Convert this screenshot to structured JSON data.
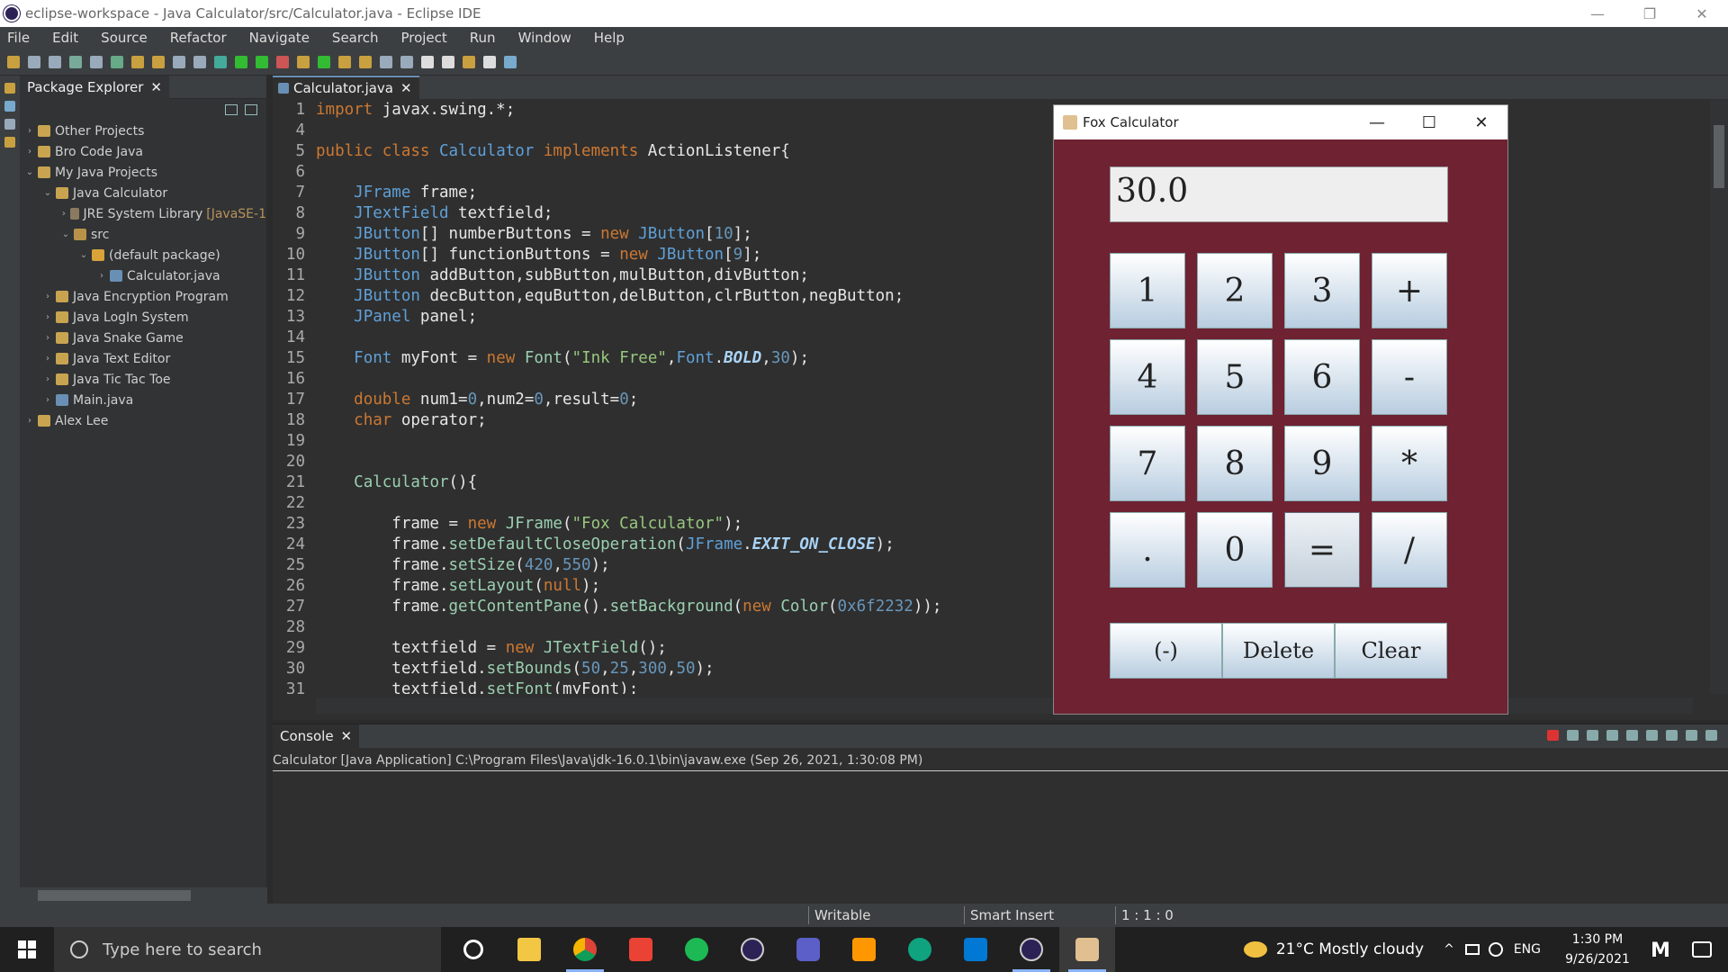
{
  "window": {
    "title": "eclipse-workspace - Java Calculator/src/Calculator.java - Eclipse IDE"
  },
  "menu": [
    "File",
    "Edit",
    "Source",
    "Refactor",
    "Navigate",
    "Search",
    "Project",
    "Run",
    "Window",
    "Help"
  ],
  "package_explorer": {
    "tab_label": "Package Explorer",
    "items": [
      {
        "label": "Other Projects",
        "extra": ""
      },
      {
        "label": "Bro Code Java",
        "extra": ""
      },
      {
        "label": "My Java Projects",
        "extra": ""
      },
      {
        "label": "Java Calculator",
        "extra": ""
      },
      {
        "label": "JRE System Library",
        "extra": "[JavaSE-1"
      },
      {
        "label": "src",
        "extra": ""
      },
      {
        "label": "(default package)",
        "extra": ""
      },
      {
        "label": "Calculator.java",
        "extra": ""
      },
      {
        "label": "Java Encryption Program",
        "extra": ""
      },
      {
        "label": "Java LogIn System",
        "extra": ""
      },
      {
        "label": "Java Snake Game",
        "extra": ""
      },
      {
        "label": "Java Text Editor",
        "extra": ""
      },
      {
        "label": "Java Tic Tac Toe",
        "extra": ""
      },
      {
        "label": "Main.java",
        "extra": ""
      },
      {
        "label": "Alex Lee",
        "extra": ""
      }
    ]
  },
  "editor": {
    "tab_label": "Calculator.java",
    "line_numbers": [
      "1",
      "4",
      "5",
      "6",
      "7",
      "8",
      "9",
      "10",
      "11",
      "12",
      "13",
      "14",
      "15",
      "16",
      "17",
      "18",
      "19",
      "20",
      "21",
      "22",
      "23",
      "24",
      "25",
      "26",
      "27",
      "28",
      "29",
      "30",
      "31"
    ]
  },
  "console": {
    "tab_label": "Console",
    "description": "Calculator [Java Application] C:\\Program Files\\Java\\jdk-16.0.1\\bin\\javaw.exe  (Sep 26, 2021, 1:30:08 PM)"
  },
  "statusbar": {
    "writable": "Writable",
    "insert_mode": "Smart Insert",
    "position": "1 : 1 : 0"
  },
  "calculator": {
    "title": "Fox Calculator",
    "display": "30.0",
    "buttons": [
      "1",
      "2",
      "3",
      "+",
      "4",
      "5",
      "6",
      "-",
      "7",
      "8",
      "9",
      "*",
      ".",
      "0",
      "=",
      "/"
    ],
    "function_buttons": [
      "(-)",
      "Delete",
      "Clear"
    ],
    "background_color": "#6f2232"
  },
  "taskbar": {
    "search_placeholder": "Type here to search",
    "weather": "21°C  Mostly cloudy",
    "language": "ENG",
    "time": "1:30 PM",
    "date": "9/26/2021"
  }
}
